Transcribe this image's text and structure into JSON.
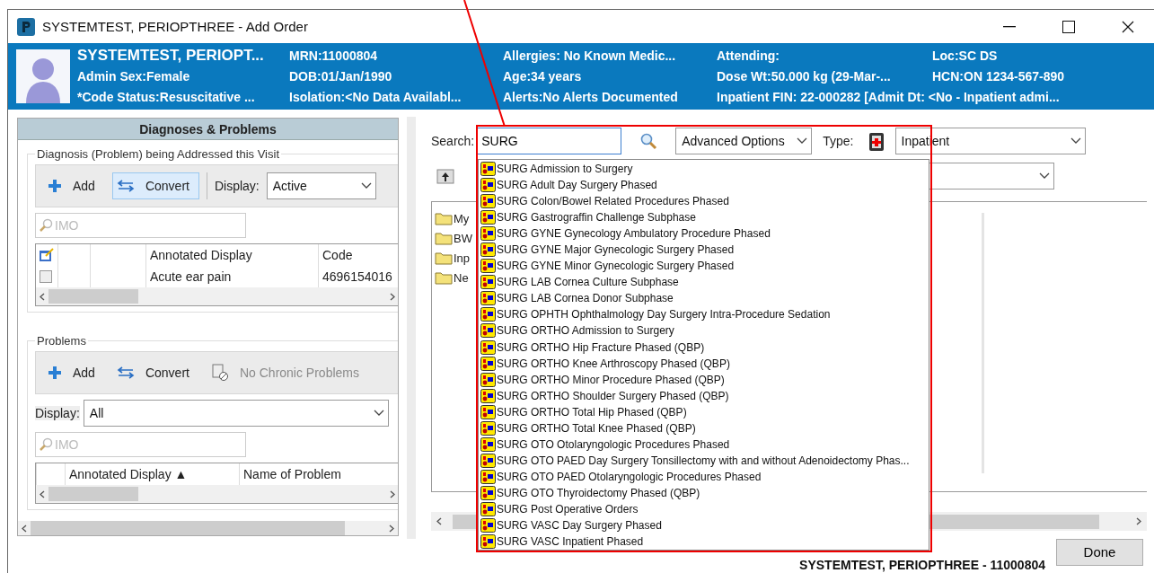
{
  "window": {
    "title": "SYSTEMTEST, PERIOPTHREE - Add Order"
  },
  "banner": {
    "rows": [
      [
        "SYSTEMTEST, PERIOPT...",
        "MRN:11000804",
        "Allergies: No Known Medic...",
        "Attending:",
        "Loc:SC DS"
      ],
      [
        "Admin Sex:Female",
        "DOB:01/Jan/1990",
        "Age:34 years",
        "Dose Wt:50.000 kg (29-Mar-...",
        "HCN:ON 1234-567-890"
      ],
      [
        "*Code Status:Resuscitative ...",
        "Isolation:<No Data Availabl...",
        "Alerts:No Alerts Documented",
        "Inpatient FIN: 22-000282 [Admit Dt: <No - Inpatient admi..."
      ]
    ]
  },
  "diagnoses_panel": {
    "title": "Diagnoses & Problems",
    "visit_group": {
      "legend": "Diagnosis (Problem) being Addressed this Visit",
      "toolbar": [
        {
          "kind": "add",
          "label": "Add",
          "selected": false,
          "disabled": false
        },
        {
          "kind": "convert",
          "label": "Convert",
          "selected": true,
          "disabled": false
        }
      ],
      "display_label": "Display:",
      "display_value": "Active",
      "search_placeholder": "IMO",
      "columns": [
        "Annotated Display",
        "Code"
      ],
      "rows": [
        {
          "checked": false,
          "annotated_display": "Acute ear pain",
          "code": "4696154016"
        }
      ]
    },
    "problems_group": {
      "legend": "Problems",
      "toolbar": [
        {
          "kind": "add",
          "label": "Add",
          "selected": false,
          "disabled": false
        },
        {
          "kind": "convert",
          "label": "Convert",
          "selected": false,
          "disabled": false
        },
        {
          "kind": "no_chronic",
          "label": "No Chronic Problems",
          "selected": false,
          "disabled": true
        }
      ],
      "display_label": "Display:",
      "display_value": "All",
      "search_placeholder": "IMO",
      "columns": [
        "Annotated Display ▲",
        "Name of Problem"
      ]
    }
  },
  "order_search": {
    "label": "Search:",
    "value": "SURG",
    "advanced_options": "Advanced Options",
    "type_label": "Type:",
    "type_value": "Inpatient",
    "folders": [
      "My",
      "BW",
      "Inp",
      "Ne"
    ],
    "suggestions": [
      "SURG Admission to Surgery",
      "SURG Adult Day Surgery Phased",
      "SURG Colon/Bowel Related Procedures Phased",
      "SURG Gastrograffin Challenge Subphase",
      "SURG GYNE Gynecology Ambulatory Procedure Phased",
      "SURG GYNE Major Gynecologic Surgery Phased",
      "SURG GYNE Minor Gynecologic Surgery Phased",
      "SURG LAB Cornea Culture Subphase",
      "SURG LAB Cornea Donor Subphase",
      "SURG OPHTH Ophthalmology Day Surgery Intra-Procedure Sedation",
      "SURG ORTHO Admission to Surgery",
      "SURG ORTHO Hip Fracture Phased (QBP)",
      "SURG ORTHO Knee Arthroscopy Phased (QBP)",
      "SURG ORTHO Minor Procedure Phased (QBP)",
      "SURG ORTHO Shoulder Surgery Phased (QBP)",
      "SURG ORTHO Total Hip Phased (QBP)",
      "SURG ORTHO Total Knee Phased (QBP)",
      "SURG OTO Otolaryngologic Procedures Phased",
      "SURG OTO PAED Day Surgery Tonsillectomy with and without Adenoidectomy Phas...",
      "SURG OTO PAED Otolaryngologic Procedures Phased",
      "SURG OTO Thyroidectomy Phased (QBP)",
      "SURG Post Operative Orders",
      "SURG VASC Day Surgery Phased",
      "SURG VASC Inpatient Phased"
    ]
  },
  "footer": {
    "patient": "SYSTEMTEST, PERIOPTHREE - 11000804",
    "done": "Done"
  }
}
